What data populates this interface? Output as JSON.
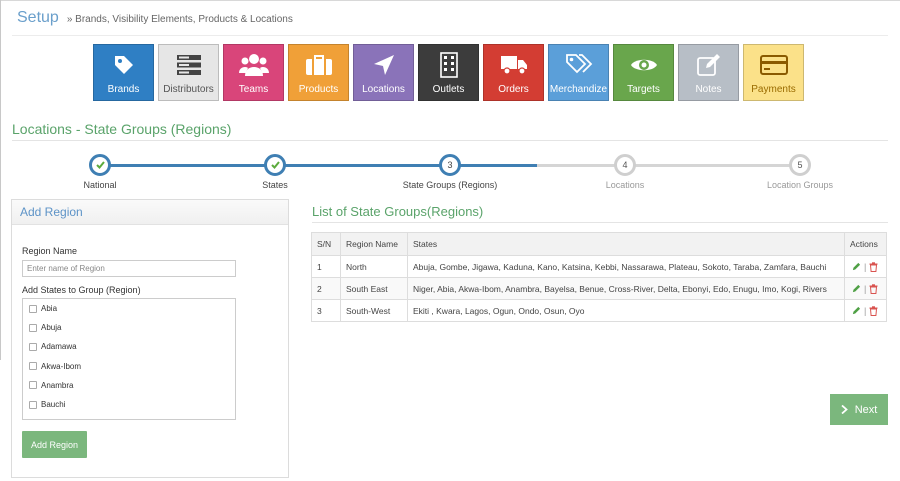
{
  "header": {
    "title": "Setup",
    "subtitle": "» Brands, Visibility Elements, Products & Locations"
  },
  "tiles": [
    {
      "label": "Brands",
      "icon": "tag-icon",
      "color": "#2f7fc4"
    },
    {
      "label": "Distributors",
      "icon": "server-stack-icon",
      "color": "#e6e6e6"
    },
    {
      "label": "Teams",
      "icon": "users-icon",
      "color": "#d9457a"
    },
    {
      "label": "Products",
      "icon": "briefcase-icon",
      "color": "#f0a038"
    },
    {
      "label": "Locations",
      "icon": "location-arrow-icon",
      "color": "#8a73b9"
    },
    {
      "label": "Outlets",
      "icon": "building-icon",
      "color": "#3c3c3c"
    },
    {
      "label": "Orders",
      "icon": "truck-icon",
      "color": "#d33d33"
    },
    {
      "label": "Merchandize",
      "icon": "tags-icon",
      "color": "#5b9fd9"
    },
    {
      "label": "Targets",
      "icon": "eye-icon",
      "color": "#69a64c"
    },
    {
      "label": "Notes",
      "icon": "edit-icon",
      "color": "#b7bec6"
    },
    {
      "label": "Payments",
      "icon": "credit-card-icon",
      "color": "#fbe189"
    }
  ],
  "section_title": "Locations - State Groups (Regions)",
  "steps": [
    {
      "label": "National",
      "status": "done",
      "number": ""
    },
    {
      "label": "States",
      "status": "done",
      "number": ""
    },
    {
      "label": "State Groups (Regions)",
      "status": "active",
      "number": "3"
    },
    {
      "label": "Locations",
      "status": "pending",
      "number": "4"
    },
    {
      "label": "Location Groups",
      "status": "pending",
      "number": "5"
    }
  ],
  "add_region": {
    "title": "Add Region",
    "name_label": "Region Name",
    "name_placeholder": "Enter name of Region",
    "states_label": "Add States to Group (Region)",
    "states": [
      "Abia",
      "Abuja",
      "Adamawa",
      "Akwa-Ibom",
      "Anambra",
      "Bauchi"
    ],
    "button_label": "Add Region"
  },
  "list": {
    "title": "List of State Groups(Regions)",
    "columns": [
      "S/N",
      "Region Name",
      "States",
      "Actions"
    ],
    "rows": [
      {
        "sn": "1",
        "region": "North",
        "states": "Abuja, Gombe, Jigawa, Kaduna, Kano, Katsina, Kebbi, Nassarawa, Plateau, Sokoto, Taraba, Zamfara, Bauchi"
      },
      {
        "sn": "2",
        "region": "South East",
        "states": "Niger, Abia, Akwa-Ibom, Anambra, Bayelsa, Benue, Cross-River, Delta, Ebonyi, Edo, Enugu, Imo, Kogi, Rivers"
      },
      {
        "sn": "3",
        "region": "South-West",
        "states": "Ekiti , Kwara, Lagos, Ogun, Ondo, Osun, Oyo"
      }
    ],
    "action_separator": "|"
  },
  "next_label": "Next",
  "colors": {
    "accent_green": "#5aa36a",
    "accent_blue": "#3f7fb3",
    "button_green": "#7bb77d",
    "edit_icon": "#4fa045",
    "delete_icon": "#d9534f"
  }
}
